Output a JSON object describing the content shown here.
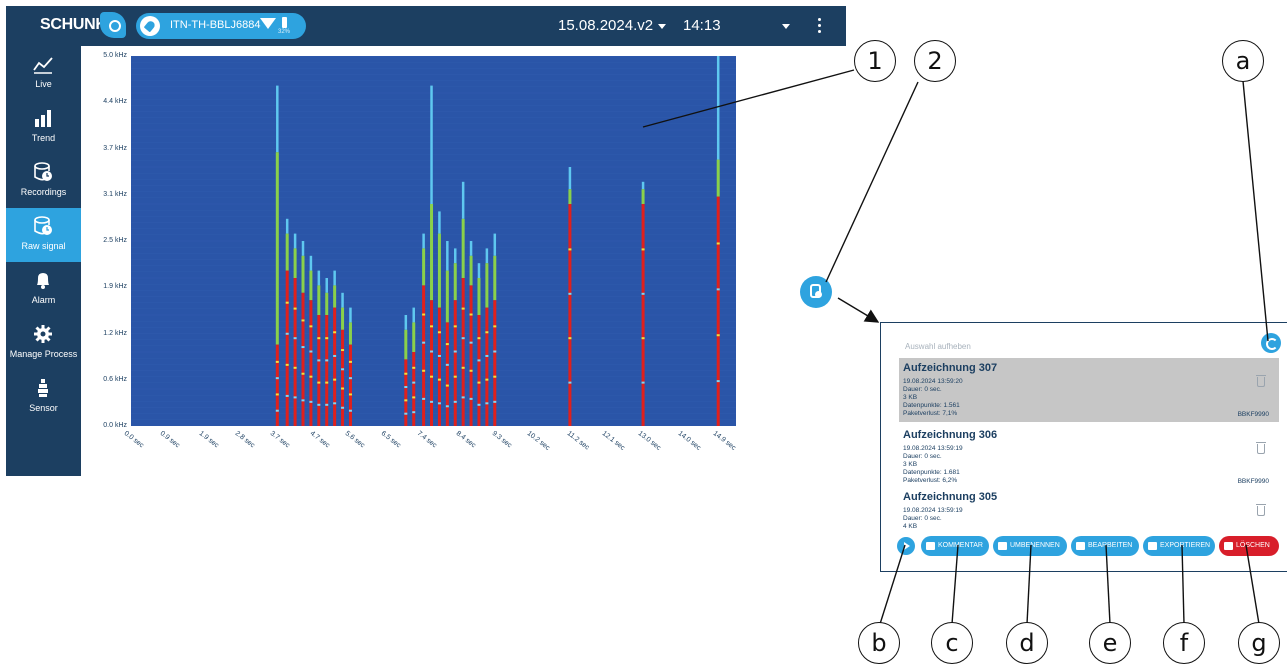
{
  "topbar": {
    "brand": "SCHUNK",
    "device_name": "ITN-TH-BBLJ6884",
    "battery": "32%",
    "version": "15.08.2024.v2",
    "time": "14:13"
  },
  "sidebar": {
    "items": [
      {
        "label": "Live",
        "icon": "line-chart-icon",
        "active": false
      },
      {
        "label": "Trend",
        "icon": "bar-chart-icon",
        "active": false
      },
      {
        "label": "Recordings",
        "icon": "database-clock-icon",
        "active": false
      },
      {
        "label": "Raw signal",
        "icon": "database-clock-icon",
        "active": true
      },
      {
        "label": "Alarm",
        "icon": "bell-icon",
        "active": false
      },
      {
        "label": "Manage Process",
        "icon": "gear-icon",
        "active": false
      },
      {
        "label": "Sensor",
        "icon": "sensor-icon",
        "active": false
      }
    ]
  },
  "chart_data": {
    "type": "heatmap",
    "y_ticks": [
      "5.0 kHz",
      "4.4 kHz",
      "3.7 kHz",
      "3.1 kHz",
      "2.5 kHz",
      "1.9 kHz",
      "1.2 kHz",
      "0.6 kHz",
      "0.0 kHz"
    ],
    "x_ticks": [
      "0.0 sec",
      "0.9 sec",
      "1.9 sec",
      "2.8 sec",
      "3.7 sec",
      "4.7 sec",
      "5.6 sec",
      "6.5 sec",
      "7.4 sec",
      "8.4 sec",
      "9.3 sec",
      "10.2 sec",
      "11.2 sec",
      "12.1 sec",
      "13.0 sec",
      "14.0 sec",
      "14.9 sec"
    ],
    "x_range_sec": [
      0.0,
      15.3
    ],
    "y_range_khz": [
      0.0,
      5.0
    ],
    "background_color": "#2a55a8",
    "stripes": [
      {
        "t": 3.7,
        "red_top_khz": 1.1,
        "green_top_khz": 3.7,
        "tail_top_khz": 4.6
      },
      {
        "t": 3.95,
        "red_top_khz": 2.1,
        "green_top_khz": 2.6,
        "tail_top_khz": 2.8
      },
      {
        "t": 4.15,
        "red_top_khz": 2.0,
        "green_top_khz": 2.4,
        "tail_top_khz": 2.6
      },
      {
        "t": 4.35,
        "red_top_khz": 1.8,
        "green_top_khz": 2.3,
        "tail_top_khz": 2.5
      },
      {
        "t": 4.55,
        "red_top_khz": 1.7,
        "green_top_khz": 2.1,
        "tail_top_khz": 2.3
      },
      {
        "t": 4.75,
        "red_top_khz": 1.5,
        "green_top_khz": 1.9,
        "tail_top_khz": 2.1
      },
      {
        "t": 4.95,
        "red_top_khz": 1.5,
        "green_top_khz": 1.8,
        "tail_top_khz": 2.0
      },
      {
        "t": 5.15,
        "red_top_khz": 1.6,
        "green_top_khz": 1.9,
        "tail_top_khz": 2.1
      },
      {
        "t": 5.35,
        "red_top_khz": 1.3,
        "green_top_khz": 1.6,
        "tail_top_khz": 1.8
      },
      {
        "t": 5.55,
        "red_top_khz": 1.1,
        "green_top_khz": 1.4,
        "tail_top_khz": 1.6
      },
      {
        "t": 6.95,
        "red_top_khz": 0.9,
        "green_top_khz": 1.3,
        "tail_top_khz": 1.5
      },
      {
        "t": 7.15,
        "red_top_khz": 1.0,
        "green_top_khz": 1.4,
        "tail_top_khz": 1.6
      },
      {
        "t": 7.4,
        "red_top_khz": 1.9,
        "green_top_khz": 2.4,
        "tail_top_khz": 2.6
      },
      {
        "t": 7.6,
        "red_top_khz": 1.7,
        "green_top_khz": 3.0,
        "tail_top_khz": 4.6
      },
      {
        "t": 7.8,
        "red_top_khz": 1.6,
        "green_top_khz": 2.6,
        "tail_top_khz": 2.9
      },
      {
        "t": 8.0,
        "red_top_khz": 1.4,
        "green_top_khz": 2.1,
        "tail_top_khz": 2.5
      },
      {
        "t": 8.2,
        "red_top_khz": 1.7,
        "green_top_khz": 2.2,
        "tail_top_khz": 2.4
      },
      {
        "t": 8.4,
        "red_top_khz": 2.0,
        "green_top_khz": 2.8,
        "tail_top_khz": 3.3
      },
      {
        "t": 8.6,
        "red_top_khz": 1.9,
        "green_top_khz": 2.3,
        "tail_top_khz": 2.5
      },
      {
        "t": 8.8,
        "red_top_khz": 1.5,
        "green_top_khz": 2.0,
        "tail_top_khz": 2.2
      },
      {
        "t": 9.0,
        "red_top_khz": 1.6,
        "green_top_khz": 2.2,
        "tail_top_khz": 2.4
      },
      {
        "t": 9.2,
        "red_top_khz": 1.7,
        "green_top_khz": 2.3,
        "tail_top_khz": 2.6
      },
      {
        "t": 11.1,
        "red_top_khz": 3.0,
        "green_top_khz": 3.2,
        "tail_top_khz": 3.5
      },
      {
        "t": 12.95,
        "red_top_khz": 3.0,
        "green_top_khz": 3.2,
        "tail_top_khz": 3.3
      },
      {
        "t": 14.85,
        "red_top_khz": 3.1,
        "green_top_khz": 3.6,
        "tail_top_khz": 5.0
      }
    ]
  },
  "recordings_panel": {
    "deselect_placeholder": "Auswahl aufheben",
    "recordings": [
      {
        "title": "Aufzeichnung 307",
        "datetime": "19.08.2024 13:59:20",
        "duration": "Dauer: 0 sec.",
        "size": "3 KB",
        "datapoints": "Datenpunkte: 1.561",
        "packet_loss": "Paketverlust: 7,1%",
        "tag": "BBKF9990",
        "selected": true
      },
      {
        "title": "Aufzeichnung 306",
        "datetime": "19.08.2024 13:59:19",
        "duration": "Dauer: 0 sec.",
        "size": "3 KB",
        "datapoints": "Datenpunkte: 1.681",
        "packet_loss": "Paketverlust: 6,2%",
        "tag": "BBKF9990",
        "selected": false
      },
      {
        "title": "Aufzeichnung 305",
        "datetime": "19.08.2024 13:59:19",
        "duration": "Dauer: 0 sec.",
        "size": "4 KB",
        "selected": false
      }
    ],
    "buttons": {
      "comment": "KOMMENTAR",
      "rename": "UMBENENNEN",
      "edit": "BEARBEITEN",
      "export": "EXPORTIEREN",
      "delete": "LÖSCHEN"
    }
  },
  "annotations": {
    "n1": "1",
    "n2": "2",
    "a": "a",
    "b": "b",
    "c": "c",
    "d": "d",
    "e": "e",
    "f": "f",
    "g": "g"
  },
  "colors": {
    "navy": "#1c3f61",
    "accent": "#2ea3df",
    "danger": "#d81e2a",
    "selected_row": "#c6c6c6"
  }
}
